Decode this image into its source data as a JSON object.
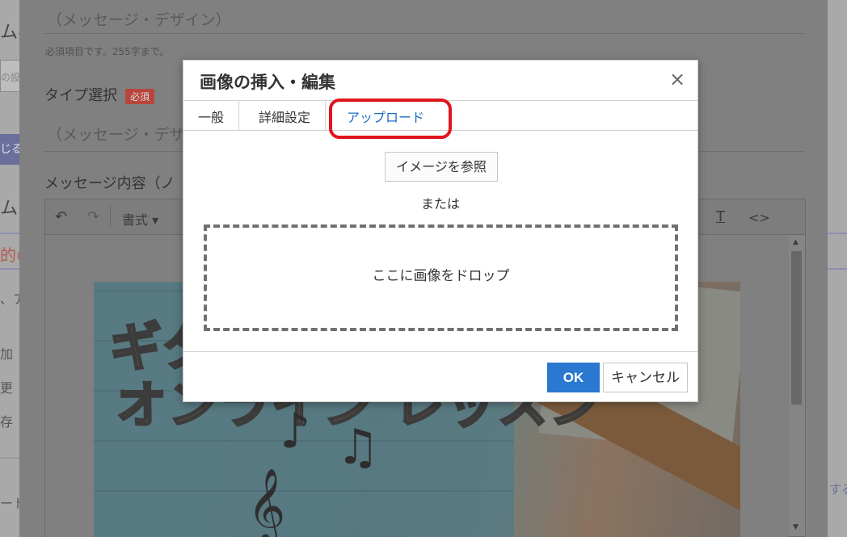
{
  "background": {
    "form": {
      "name_placeholder": "（メッセージ・デザイン）",
      "name_hint": "必須項目です。255字まで。",
      "type_label": "タイプ選択",
      "required_badge": "必須",
      "type_placeholder": "（メッセージ・デザ",
      "content_label": "メッセージ内容（ノ"
    },
    "left_fragments": [
      "ム名",
      "の設",
      "じる",
      "ムの",
      "的の",
      "、ア",
      "加",
      "更",
      "存",
      "ート"
    ],
    "right_fragment": "する",
    "toolbar": {
      "undo_icon": "↶",
      "redo_icon": "↷",
      "format_label": "書式 ▾",
      "clear_format_icon": "T",
      "source_icon": "<>"
    },
    "image_overlay": {
      "line1": "ギタ",
      "line2": "オンライン レッスン"
    }
  },
  "dialog": {
    "title": "画像の挿入・編集",
    "close_icon": "×",
    "tabs": [
      {
        "label": "一般"
      },
      {
        "label": "詳細設定"
      },
      {
        "label": "アップロード"
      }
    ],
    "active_tab": "アップロード",
    "browse_button": "イメージを参照",
    "or_text": "または",
    "drop_zone_text": "ここに画像をドロップ",
    "ok_button": "OK",
    "cancel_button": "キャンセル"
  },
  "colors": {
    "accent": "#2a78d0",
    "highlight": "#e0161e",
    "active_tab": "#1a6ec4"
  }
}
